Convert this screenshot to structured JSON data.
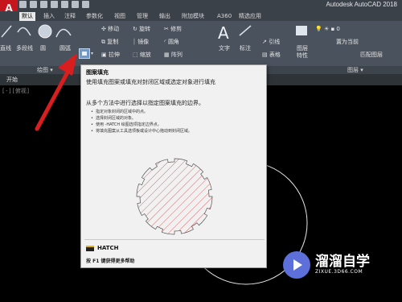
{
  "app": {
    "logo": "A",
    "title": "Autodesk AutoCAD 2018"
  },
  "tabs": [
    "默认",
    "插入",
    "注释",
    "参数化",
    "视图",
    "管理",
    "输出",
    "附加模块",
    "A360",
    "精选应用"
  ],
  "ribbon": {
    "draw": {
      "line": "直线",
      "polyline": "多段线",
      "circle": "圆",
      "arc": "圆弧"
    },
    "modify": {
      "move": "移动",
      "rotate": "旋转",
      "trim": "修剪",
      "copy": "复制",
      "mirror": "镜像",
      "fillet": "圆角",
      "stretch": "拉伸",
      "scale": "缩放",
      "array": "阵列"
    },
    "annotation": {
      "text": "文字",
      "dimension": "标注",
      "leader": "引线",
      "table": "表格"
    },
    "layers": {
      "properties_line1": "图层",
      "properties_line2": "特性",
      "layer_value": "0",
      "make_current": "置为当前",
      "match": "匹配图层"
    },
    "panels": {
      "draw": "绘图",
      "layers": "图层"
    }
  },
  "document_tab": "开始",
  "canvas_bracket": "[-][俯视]",
  "tooltip": {
    "title": "图案填充",
    "description": "使用填充图案或填充对封闭区域或选定对象进行填充",
    "subtitle": "从多个方法中进行选择以指定图案填充的边界。",
    "bullets": [
      "指定对象封闭的区域中的点。",
      "选择封闭区域的对象。",
      "使用 -HATCH 绘图选项指定边界点。",
      "将填充图案从工具选项板或设计中心拖动到封闭区域。"
    ],
    "command": "HATCH",
    "help": "按 F1 键获得更多帮助"
  },
  "watermark": {
    "name": "溜溜自学",
    "url": "ZIXUE.3D66.COM"
  },
  "colors": {
    "accent_red": "#c4161c",
    "ribbon": "#4a525d",
    "hatch": "#d04848",
    "watermark_logo": "#5d6fd8"
  }
}
